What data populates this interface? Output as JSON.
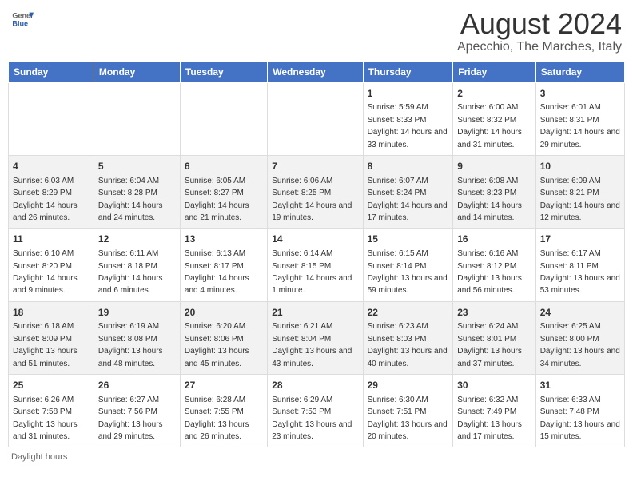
{
  "header": {
    "logo_general": "General",
    "logo_blue": "Blue",
    "title": "August 2024",
    "subtitle": "Apecchio, The Marches, Italy"
  },
  "days_of_week": [
    "Sunday",
    "Monday",
    "Tuesday",
    "Wednesday",
    "Thursday",
    "Friday",
    "Saturday"
  ],
  "weeks": [
    [
      {
        "day": "",
        "info": ""
      },
      {
        "day": "",
        "info": ""
      },
      {
        "day": "",
        "info": ""
      },
      {
        "day": "",
        "info": ""
      },
      {
        "day": "1",
        "info": "Sunrise: 5:59 AM\nSunset: 8:33 PM\nDaylight: 14 hours and 33 minutes."
      },
      {
        "day": "2",
        "info": "Sunrise: 6:00 AM\nSunset: 8:32 PM\nDaylight: 14 hours and 31 minutes."
      },
      {
        "day": "3",
        "info": "Sunrise: 6:01 AM\nSunset: 8:31 PM\nDaylight: 14 hours and 29 minutes."
      }
    ],
    [
      {
        "day": "4",
        "info": "Sunrise: 6:03 AM\nSunset: 8:29 PM\nDaylight: 14 hours and 26 minutes."
      },
      {
        "day": "5",
        "info": "Sunrise: 6:04 AM\nSunset: 8:28 PM\nDaylight: 14 hours and 24 minutes."
      },
      {
        "day": "6",
        "info": "Sunrise: 6:05 AM\nSunset: 8:27 PM\nDaylight: 14 hours and 21 minutes."
      },
      {
        "day": "7",
        "info": "Sunrise: 6:06 AM\nSunset: 8:25 PM\nDaylight: 14 hours and 19 minutes."
      },
      {
        "day": "8",
        "info": "Sunrise: 6:07 AM\nSunset: 8:24 PM\nDaylight: 14 hours and 17 minutes."
      },
      {
        "day": "9",
        "info": "Sunrise: 6:08 AM\nSunset: 8:23 PM\nDaylight: 14 hours and 14 minutes."
      },
      {
        "day": "10",
        "info": "Sunrise: 6:09 AM\nSunset: 8:21 PM\nDaylight: 14 hours and 12 minutes."
      }
    ],
    [
      {
        "day": "11",
        "info": "Sunrise: 6:10 AM\nSunset: 8:20 PM\nDaylight: 14 hours and 9 minutes."
      },
      {
        "day": "12",
        "info": "Sunrise: 6:11 AM\nSunset: 8:18 PM\nDaylight: 14 hours and 6 minutes."
      },
      {
        "day": "13",
        "info": "Sunrise: 6:13 AM\nSunset: 8:17 PM\nDaylight: 14 hours and 4 minutes."
      },
      {
        "day": "14",
        "info": "Sunrise: 6:14 AM\nSunset: 8:15 PM\nDaylight: 14 hours and 1 minute."
      },
      {
        "day": "15",
        "info": "Sunrise: 6:15 AM\nSunset: 8:14 PM\nDaylight: 13 hours and 59 minutes."
      },
      {
        "day": "16",
        "info": "Sunrise: 6:16 AM\nSunset: 8:12 PM\nDaylight: 13 hours and 56 minutes."
      },
      {
        "day": "17",
        "info": "Sunrise: 6:17 AM\nSunset: 8:11 PM\nDaylight: 13 hours and 53 minutes."
      }
    ],
    [
      {
        "day": "18",
        "info": "Sunrise: 6:18 AM\nSunset: 8:09 PM\nDaylight: 13 hours and 51 minutes."
      },
      {
        "day": "19",
        "info": "Sunrise: 6:19 AM\nSunset: 8:08 PM\nDaylight: 13 hours and 48 minutes."
      },
      {
        "day": "20",
        "info": "Sunrise: 6:20 AM\nSunset: 8:06 PM\nDaylight: 13 hours and 45 minutes."
      },
      {
        "day": "21",
        "info": "Sunrise: 6:21 AM\nSunset: 8:04 PM\nDaylight: 13 hours and 43 minutes."
      },
      {
        "day": "22",
        "info": "Sunrise: 6:23 AM\nSunset: 8:03 PM\nDaylight: 13 hours and 40 minutes."
      },
      {
        "day": "23",
        "info": "Sunrise: 6:24 AM\nSunset: 8:01 PM\nDaylight: 13 hours and 37 minutes."
      },
      {
        "day": "24",
        "info": "Sunrise: 6:25 AM\nSunset: 8:00 PM\nDaylight: 13 hours and 34 minutes."
      }
    ],
    [
      {
        "day": "25",
        "info": "Sunrise: 6:26 AM\nSunset: 7:58 PM\nDaylight: 13 hours and 31 minutes."
      },
      {
        "day": "26",
        "info": "Sunrise: 6:27 AM\nSunset: 7:56 PM\nDaylight: 13 hours and 29 minutes."
      },
      {
        "day": "27",
        "info": "Sunrise: 6:28 AM\nSunset: 7:55 PM\nDaylight: 13 hours and 26 minutes."
      },
      {
        "day": "28",
        "info": "Sunrise: 6:29 AM\nSunset: 7:53 PM\nDaylight: 13 hours and 23 minutes."
      },
      {
        "day": "29",
        "info": "Sunrise: 6:30 AM\nSunset: 7:51 PM\nDaylight: 13 hours and 20 minutes."
      },
      {
        "day": "30",
        "info": "Sunrise: 6:32 AM\nSunset: 7:49 PM\nDaylight: 13 hours and 17 minutes."
      },
      {
        "day": "31",
        "info": "Sunrise: 6:33 AM\nSunset: 7:48 PM\nDaylight: 13 hours and 15 minutes."
      }
    ]
  ],
  "footer": {
    "label": "Daylight hours"
  }
}
